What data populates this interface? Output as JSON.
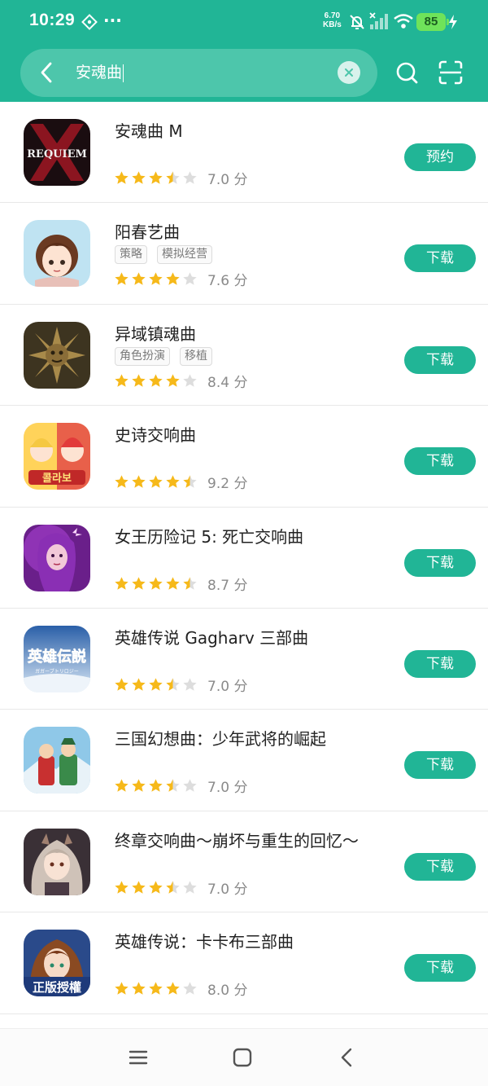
{
  "status_bar": {
    "time": "10:29",
    "dots": "···",
    "net_speed_value": "6.70",
    "net_speed_unit": "KB/s",
    "battery": "85",
    "icons": [
      "vpn-icon",
      "dnd-bell-icon",
      "signal-icon",
      "wifi-icon",
      "battery-icon",
      "charging-icon"
    ]
  },
  "search": {
    "query": "安魂曲",
    "icons": [
      "back-icon",
      "clear-icon",
      "search-icon",
      "scan-icon"
    ]
  },
  "apps": [
    {
      "name": "安魂曲 M",
      "tags": [],
      "rating": 3.5,
      "score": "7.0 分",
      "action": "预约",
      "icon": "requiem-logo-icon"
    },
    {
      "name": "阳春艺曲",
      "tags": [
        "策略",
        "模拟经营"
      ],
      "rating": 4,
      "score": "7.6 分",
      "action": "下载",
      "icon": "anime-girl-icon"
    },
    {
      "name": "异域镇魂曲",
      "tags": [
        "角色扮演",
        "移植"
      ],
      "rating": 4,
      "score": "8.4 分",
      "action": "下载",
      "icon": "bronze-face-icon"
    },
    {
      "name": "史诗交响曲",
      "tags": [],
      "rating": 4.5,
      "score": "9.2 分",
      "action": "下载",
      "icon": "anime-duo-icon"
    },
    {
      "name": "女王历险记 5: 死亡交响曲",
      "tags": [],
      "rating": 4.5,
      "score": "8.7 分",
      "action": "下载",
      "icon": "purple-queen-icon"
    },
    {
      "name": "英雄传说 Gagharv 三部曲",
      "tags": [],
      "rating": 3.5,
      "score": "7.0 分",
      "action": "下载",
      "icon": "eiyuu-densetsu-icon"
    },
    {
      "name": "三国幻想曲：少年武将的崛起",
      "tags": [],
      "rating": 3.5,
      "score": "7.0 分",
      "action": "下载",
      "icon": "three-kingdoms-icon"
    },
    {
      "name": "终章交响曲～崩坏与重生的回忆～",
      "tags": [],
      "rating": 3.5,
      "score": "7.0 分",
      "action": "下载",
      "icon": "silver-hair-girl-icon"
    },
    {
      "name": "英雄传说：卡卡布三部曲",
      "tags": [],
      "rating": 4,
      "score": "8.0 分",
      "action": "下载",
      "icon": "official-license-icon"
    }
  ],
  "icon_texts": {
    "requiem": "REQUIEM",
    "eiyuu": "英雄伝説",
    "eiyuu_sub": "ガガーブトリロジー",
    "collab": "콜라보",
    "license": "正版授權"
  },
  "nav": {
    "icons": [
      "menu-icon",
      "home-icon",
      "back-nav-icon"
    ]
  },
  "colors": {
    "brand": "#21b596",
    "star": "#f6b91a",
    "star_empty": "#dddddd"
  }
}
